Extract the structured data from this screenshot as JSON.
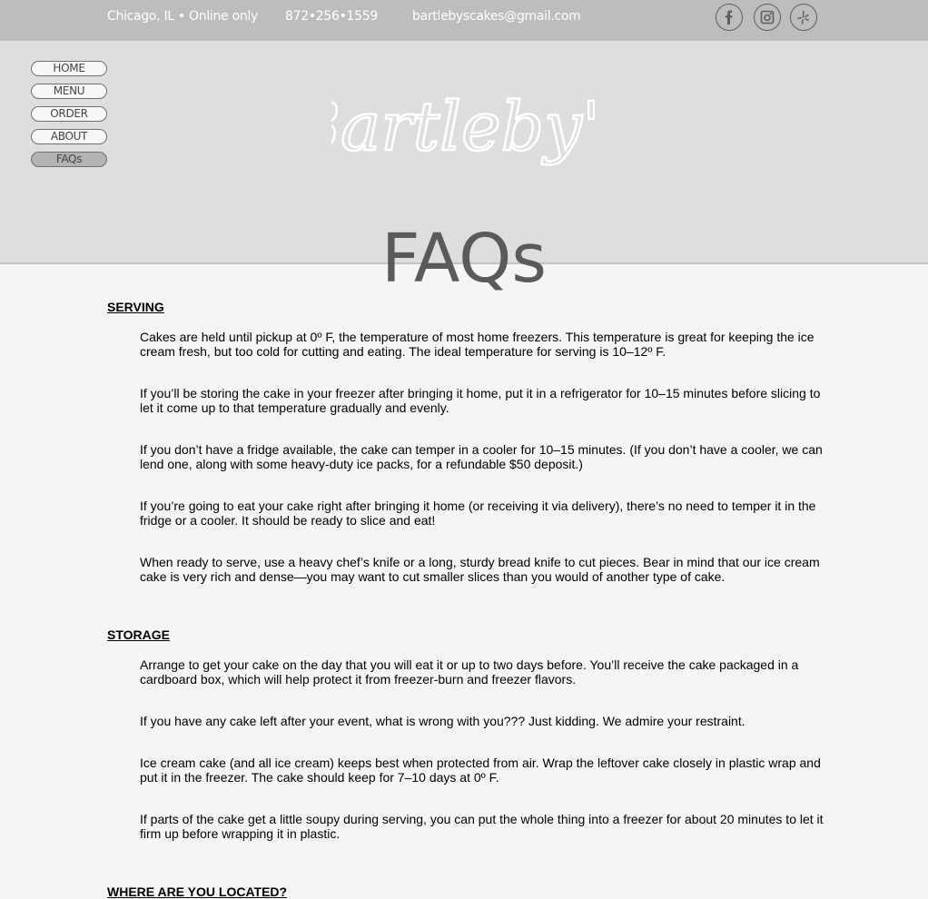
{
  "topbar": {
    "location": "Chicago, IL • Online only",
    "phone": "872•256•1559",
    "email": "bartlebyscakes@gmail.com",
    "social": [
      "facebook-icon",
      "instagram-icon",
      "yelp-icon"
    ]
  },
  "nav": {
    "items": [
      {
        "label": "HOME"
      },
      {
        "label": "MENU"
      },
      {
        "label": "ORDER"
      },
      {
        "label": "ABOUT"
      },
      {
        "label": "FAQs",
        "active": true
      }
    ]
  },
  "logo": "Bartleby's",
  "page_title": "FAQs",
  "sections": [
    {
      "heading": "SERVING",
      "paragraphs": [
        "Cakes are held until pickup at 0º F, the temperature of most home freezers. This temperature is great for keeping the ice cream fresh, but too cold for cutting and eating. The ideal temperature for serving is 10–12º F.",
        "If you’ll be storing the cake in your freezer after bringing it home, put it in a refrigerator for 10–15 minutes before slicing to let it come up to that temperature gradually and evenly.",
        "If you don’t have a fridge available, the cake can temper in a cooler for 10–15 minutes. (If you don’t have a cooler, we can lend one, along with some heavy-duty ice packs, for a refundable $50 deposit.)",
        "If you’re going to eat your cake right after bringing it home (or receiving it via delivery), there’s no need to temper it in the fridge or a cooler. It should be ready to slice and eat!",
        "When ready to serve, use a heavy chef’s knife or a long, sturdy bread knife to cut pieces. Bear in mind that our ice cream cake is very rich and dense—you may want to cut smaller slices than you would of another type of cake."
      ]
    },
    {
      "heading": "STORAGE",
      "paragraphs": [
        "Arrange to get your cake on the day that you will eat it or up to two days before. You’ll receive the cake packaged in a cardboard box, which will help protect it from freezer-burn and freezer flavors.",
        "If you have any cake left after your event, what is wrong with you??? Just kidding. We admire your restraint.",
        "Ice cream cake (and all ice cream) keeps best when protected from air. Wrap the leftover cake closely in plastic wrap and put it in the freezer. The cake should keep for 7–10 days at 0º F.",
        "If parts of the cake get a little soupy during serving, you can put the whole thing into a freezer for about 20 minutes to let it firm up before wrapping it in plastic."
      ]
    },
    {
      "heading": "WHERE ARE YOU LOCATED?",
      "paragraphs": []
    }
  ]
}
